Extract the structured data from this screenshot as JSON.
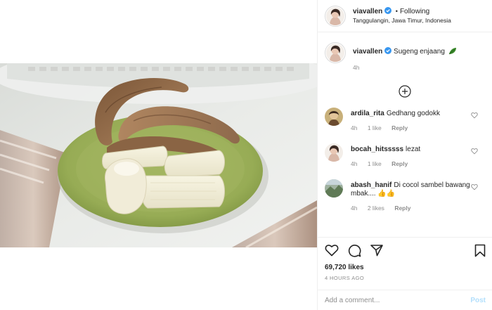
{
  "header": {
    "username": "viavallen",
    "separator": "•",
    "follow_status": "Following",
    "location": "Tanggulangin, Jawa Timur, Indonesia"
  },
  "caption": {
    "username": "viavallen",
    "text": "Sugeng enjaang",
    "emoji_icon": "leafy-green-icon",
    "time": "4h"
  },
  "comments": [
    {
      "username": "ardila_rita",
      "text": "Gedhang godokk",
      "time": "4h",
      "likes": "1 like",
      "reply": "Reply"
    },
    {
      "username": "bocah_hitsssss",
      "text": "lezat",
      "time": "4h",
      "likes": "1 like",
      "reply": "Reply"
    },
    {
      "username": "abash_hanif",
      "text": "Di cocol sambel bawang mbak....",
      "emoji": "👍👍",
      "time": "4h",
      "likes": "2 likes",
      "reply": "Reply"
    }
  ],
  "stats": {
    "likes": "69,720 likes",
    "posted": "4 HOURS AGO"
  },
  "add_comment": {
    "placeholder": "Add a comment...",
    "post_label": "Post"
  },
  "colors": {
    "verified": "#3897f0",
    "post_button_disabled": "#b2dffc",
    "secondary_text": "#8e8e8e",
    "divider": "#efefef"
  }
}
